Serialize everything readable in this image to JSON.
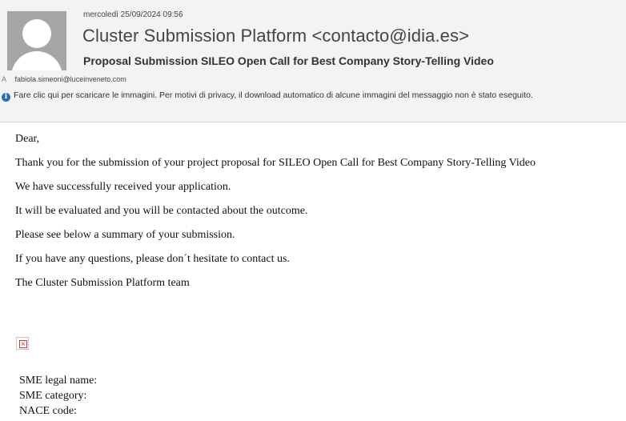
{
  "header": {
    "date": "mercoledì 25/09/2024 09:56",
    "sender": "Cluster Submission Platform <contacto@idia.es>",
    "subject": "Proposal Submission SILEO Open Call for Best Company Story-Telling Video",
    "to_label": "A",
    "recipient": "fabiola.simeoni@luceinveneto.com",
    "info_icon": "i",
    "info_text": "Fare clic qui per scaricare le immagini. Per motivi di privacy, il download automatico di alcune immagini del messaggio non è stato eseguito."
  },
  "body": {
    "lines": [
      "Dear,",
      "Thank you for the submission of your project proposal for SILEO Open Call for Best Company Story-Telling Video",
      "We have successfully received your application.",
      "It will be evaluated and you will be contacted about the outcome.",
      "Please see below a summary of your submission.",
      "If you have any questions, please don´t hesitate to contact us.",
      "The Cluster Submission Platform team"
    ],
    "broken_image_glyph": "×"
  },
  "summary": {
    "fields": [
      "SME legal name:",
      "SME category:",
      "NACE code:"
    ]
  }
}
